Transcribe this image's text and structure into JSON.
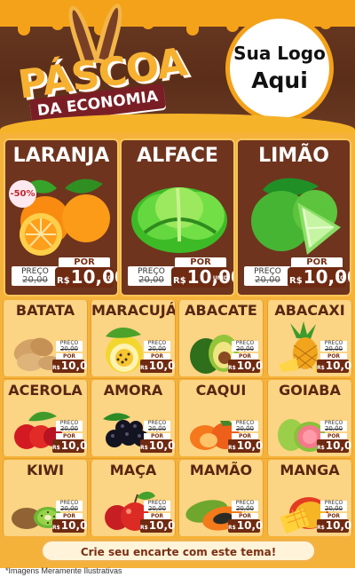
{
  "header": {
    "title_line1": "PÁSCOA",
    "title_line2": "DA ECONOMIA",
    "logo_line1": "Sua Logo",
    "logo_line2": "Aqui"
  },
  "featured": [
    {
      "name": "LARANJA",
      "discount": "-50%",
      "por": "POR",
      "preco_label": "PREÇO",
      "old": "20,00",
      "currency": "R$",
      "now": "10,00",
      "unit": "KG",
      "icon": "orange-icon"
    },
    {
      "name": "ALFACE",
      "por": "POR",
      "preco_label": "PREÇO",
      "old": "20,00",
      "currency": "R$",
      "now": "10,00",
      "unit": "UNID",
      "icon": "lettuce-icon"
    },
    {
      "name": "LIMÃO",
      "por": "POR",
      "preco_label": "PREÇO",
      "old": "20,00",
      "currency": "R$",
      "now": "10,00",
      "unit": "KG",
      "icon": "lime-icon"
    }
  ],
  "products": [
    {
      "name": "BATATA",
      "preco_label": "PREÇO",
      "old": "20,00",
      "por": "POR",
      "currency": "R$",
      "now": "10,00",
      "icon": "potato-icon"
    },
    {
      "name": "MARACUJÁ",
      "preco_label": "PREÇO",
      "old": "20,00",
      "por": "POR",
      "currency": "R$",
      "now": "10,00",
      "icon": "passion-fruit-icon"
    },
    {
      "name": "ABACATE",
      "preco_label": "PREÇO",
      "old": "20,00",
      "por": "POR",
      "currency": "R$",
      "now": "10,00",
      "icon": "avocado-icon"
    },
    {
      "name": "ABACAXI",
      "preco_label": "PREÇO",
      "old": "20,00",
      "por": "POR",
      "currency": "R$",
      "now": "10,00",
      "icon": "pineapple-icon"
    },
    {
      "name": "ACEROLA",
      "preco_label": "PREÇO",
      "old": "20,00",
      "por": "POR",
      "currency": "R$",
      "now": "10,00",
      "icon": "acerola-icon"
    },
    {
      "name": "AMORA",
      "preco_label": "PREÇO",
      "old": "20,00",
      "por": "POR",
      "currency": "R$",
      "now": "10,00",
      "icon": "blackberry-icon"
    },
    {
      "name": "CAQUI",
      "preco_label": "PREÇO",
      "old": "20,00",
      "por": "POR",
      "currency": "R$",
      "now": "10,00",
      "icon": "persimmon-icon"
    },
    {
      "name": "GOIABA",
      "preco_label": "PREÇO",
      "old": "20,00",
      "por": "POR",
      "currency": "R$",
      "now": "10,00",
      "icon": "guava-icon"
    },
    {
      "name": "KIWI",
      "preco_label": "PREÇO",
      "old": "20,00",
      "por": "POR",
      "currency": "R$",
      "now": "10,00",
      "icon": "kiwi-icon"
    },
    {
      "name": "MAÇA",
      "preco_label": "PREÇO",
      "old": "20,00",
      "por": "POR",
      "currency": "R$",
      "now": "10,00",
      "icon": "apple-icon"
    },
    {
      "name": "MAMÃO",
      "preco_label": "PREÇO",
      "old": "20,00",
      "por": "POR",
      "currency": "R$",
      "now": "10,00",
      "icon": "papaya-icon"
    },
    {
      "name": "MANGA",
      "preco_label": "PREÇO",
      "old": "20,00",
      "por": "POR",
      "currency": "R$",
      "now": "10,00",
      "icon": "mango-icon"
    }
  ],
  "footer": {
    "cta": "Crie seu encarte com este tema!",
    "note": "*Imagens Meramente Ilustrativas"
  },
  "colors": {
    "brown": "#6f341e",
    "orange": "#f5b23a",
    "gold": "#f6b131",
    "red": "#7a1e25"
  }
}
